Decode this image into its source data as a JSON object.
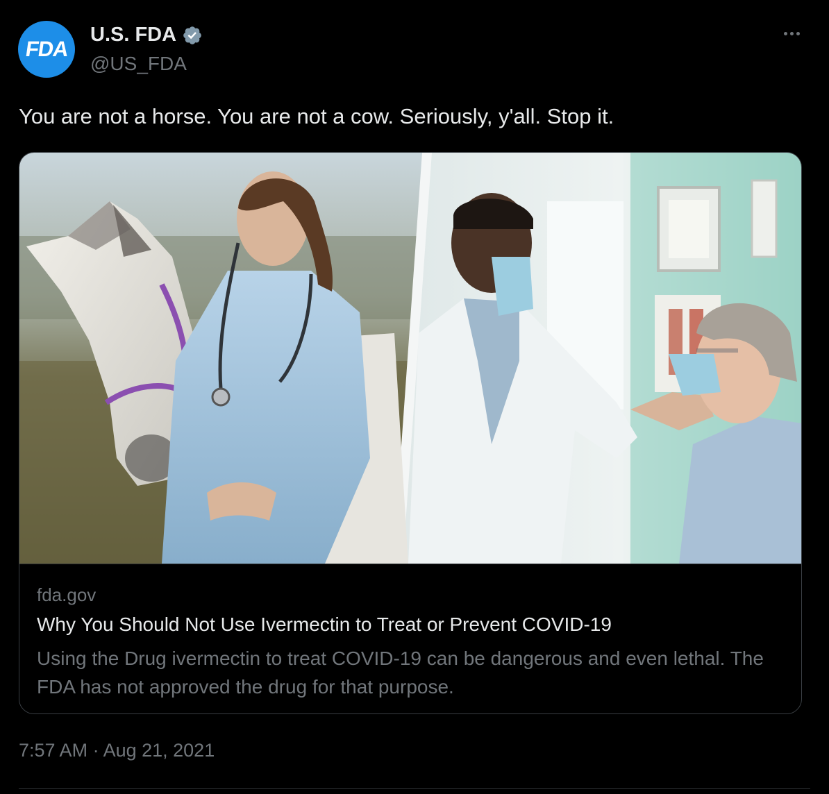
{
  "author": {
    "avatar_text": "FDA",
    "display_name": "U.S. FDA",
    "handle": "@US_FDA",
    "verified": true
  },
  "tweet": {
    "text": "You are not a horse. You are not a cow. Seriously, y'all. Stop it.",
    "timestamp": "7:57 AM · Aug 21, 2021"
  },
  "link_card": {
    "domain": "fda.gov",
    "title": "Why You Should Not Use Ivermectin to Treat or Prevent COVID-19",
    "description": "Using the Drug ivermectin to treat COVID-19 can be dangerous and even lethal. The FDA has not approved the drug for that purpose."
  },
  "icons": {
    "more": "more-horizontal-icon",
    "verified": "verified-badge-icon"
  },
  "colors": {
    "background": "#000000",
    "primary_text": "#e7e9ea",
    "secondary_text": "#71767b",
    "avatar_bg": "#1d8ee8",
    "verified_badge": "#829aab",
    "border": "#3a3f44"
  }
}
